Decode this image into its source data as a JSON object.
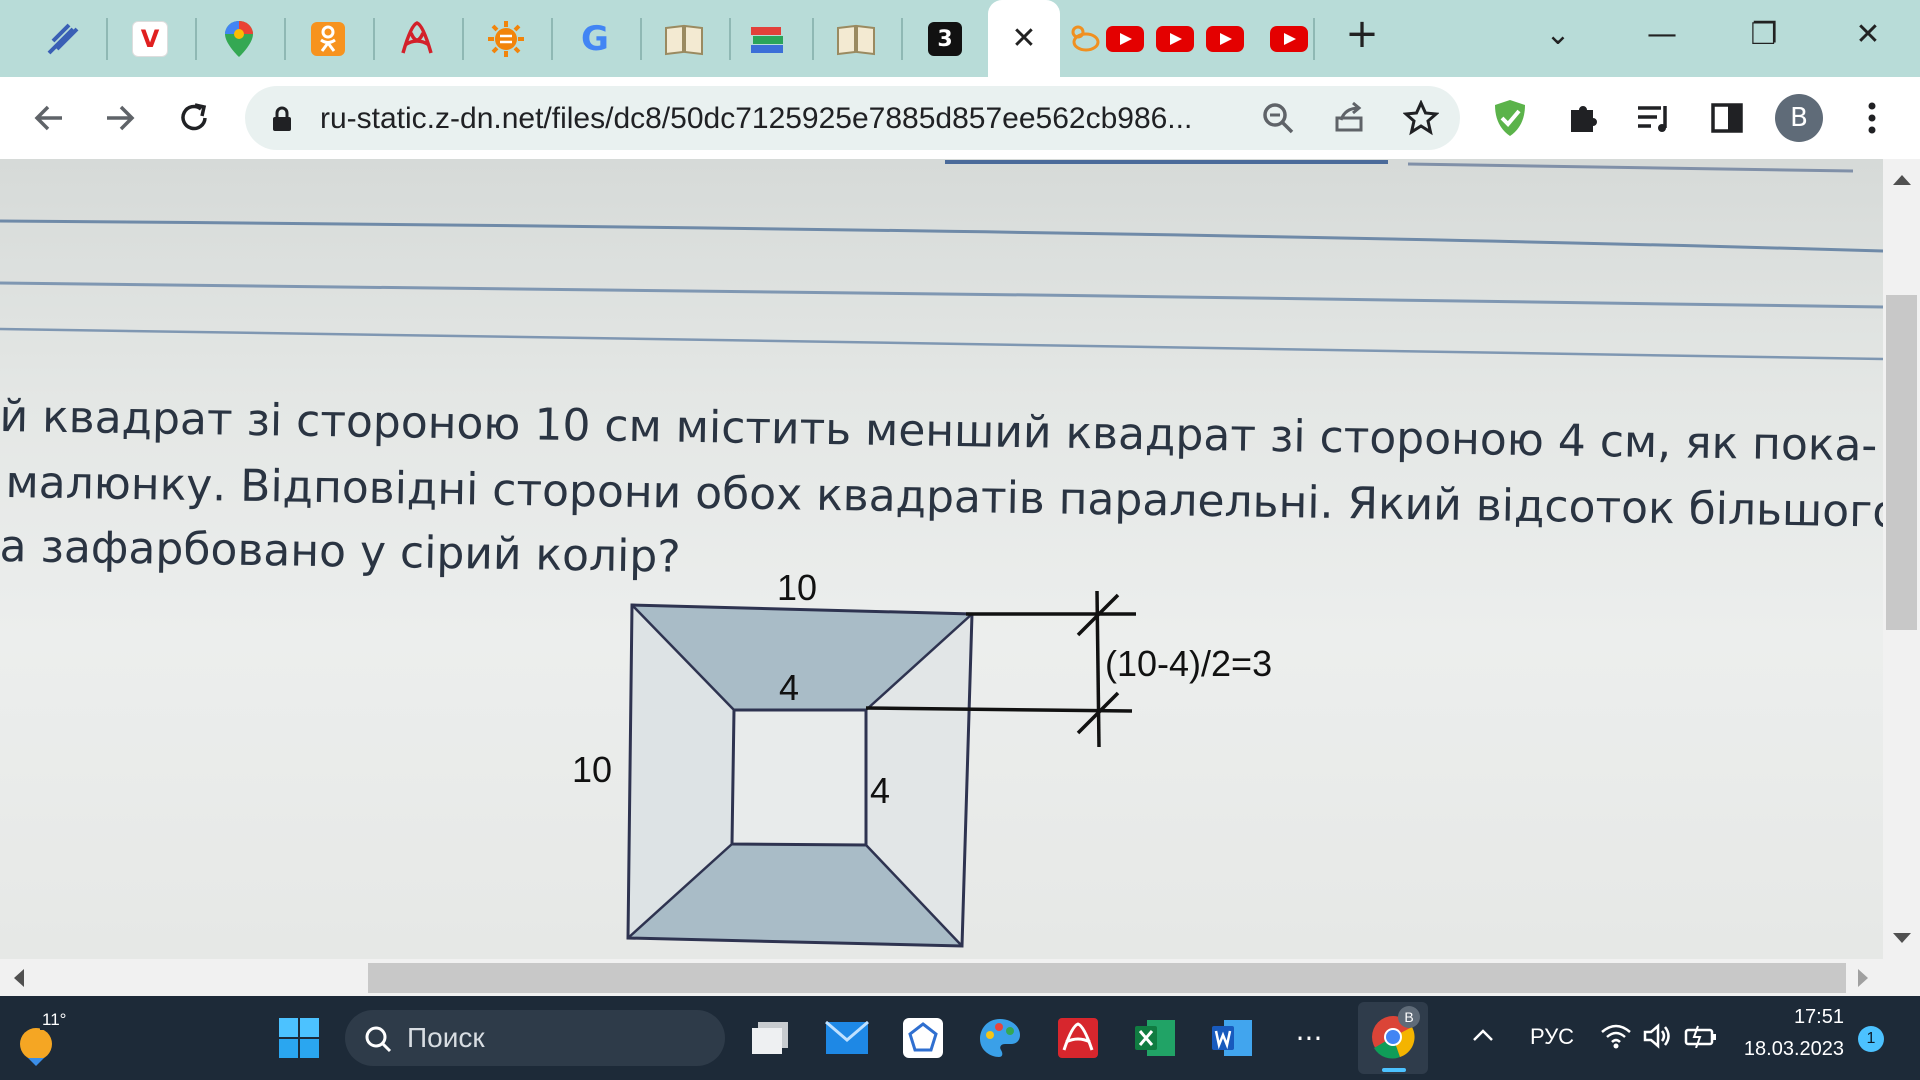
{
  "tabs": {
    "active_close": "✕",
    "new_tab": "+",
    "icons": [
      "pin-icon",
      "vivaldi-icon",
      "maps-icon",
      "odnoklassniki-icon",
      "pdf-icon",
      "sun-icon",
      "google-icon",
      "book-icon",
      "books-icon",
      "book-icon-2",
      "znanija-icon"
    ],
    "znanija_label": "3",
    "vivaldi_label": "V",
    "google_label": "G"
  },
  "window": {
    "dropdown": "⌄",
    "minimize": "—",
    "restore": "❐",
    "close": "✕"
  },
  "toolbar": {
    "url": "ru-static.z-dn.net/files/dc8/50dc7125925e7885d857ee562cb986...",
    "profile_letter": "B"
  },
  "page": {
    "line1": "й квадрат зі стороною 10 см містить менший квадрат зі стороною 4 см, як пока-",
    "line2": "малюнку. Відповідні сторони обох квадратів паралельні. Який відсоток більшого",
    "line3": "а зафарбовано у сірий колір?",
    "label_top": "10",
    "label_left": "10",
    "label_inner_top": "4",
    "label_inner_right": "4",
    "label_formula": "(10-4)/2=3"
  },
  "taskbar": {
    "weather_temp": "11°",
    "search_placeholder": "Поиск",
    "language": "РУС",
    "time": "17:51",
    "date": "18.03.2023",
    "notification_count": "1",
    "more": "···",
    "chrome_profile_badge": "B"
  },
  "colors": {
    "tabbar_bg": "#b8dcd8",
    "taskbar_bg": "#1d2a38",
    "shaded_region": "#a9bcc7",
    "youtube_red": "#e40000"
  }
}
